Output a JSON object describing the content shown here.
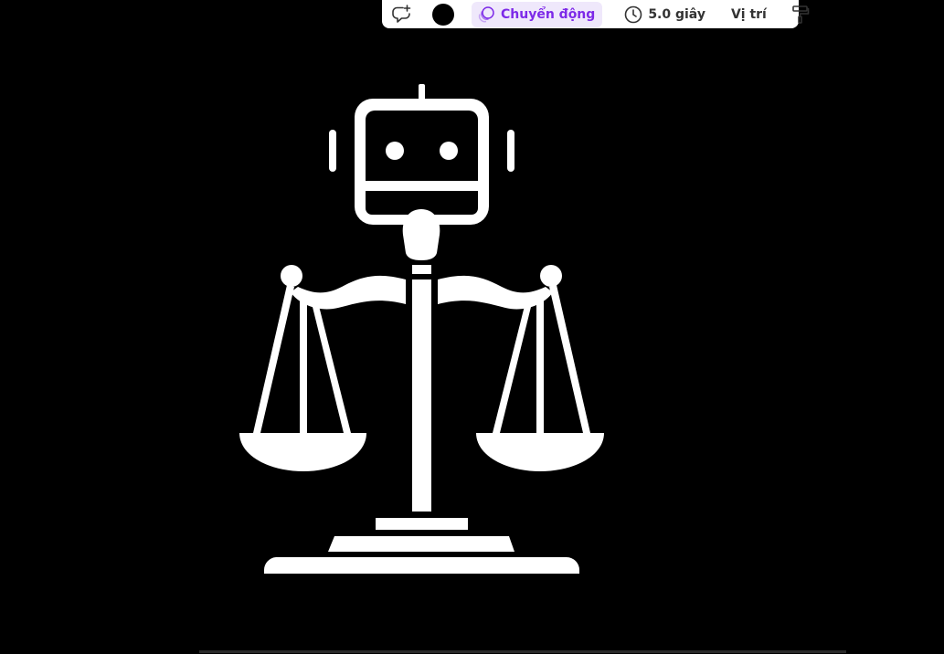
{
  "toolbar": {
    "animate_label": "Chuyển động",
    "duration_label": "5.0 giây",
    "position_label": "Vị trí",
    "color_value": "#000000",
    "accent_color": "#7d2ae8"
  },
  "canvas": {
    "background": "#000000",
    "graphic_color": "#ffffff",
    "graphic": "robot-scales-of-justice-icon"
  },
  "icons": [
    "comment-add-icon",
    "animation-icon",
    "clock-icon",
    "paint-roller-icon"
  ]
}
